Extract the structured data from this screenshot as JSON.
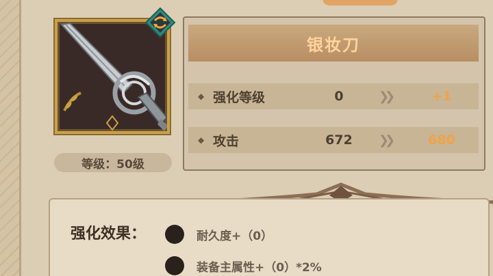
{
  "item": {
    "name": "银妆刀",
    "level_label": "等级：50级"
  },
  "stats": [
    {
      "label": "强化等级",
      "current": "0",
      "next": "+1"
    },
    {
      "label": "攻击",
      "current": "672",
      "next": "680"
    }
  ],
  "effects": {
    "title": "强化效果：",
    "items": [
      {
        "text": "耐久度+（0）"
      },
      {
        "text": "装备主属性+（0）*2%"
      }
    ]
  },
  "colors": {
    "title_text": "#ffd39a",
    "next_value": "#f1a347",
    "frame_gold": "#c9a248",
    "swap_teal": "#2f8a7e"
  },
  "icons": [
    "sword-icon",
    "swap-icon",
    "arrow-right-icon"
  ]
}
